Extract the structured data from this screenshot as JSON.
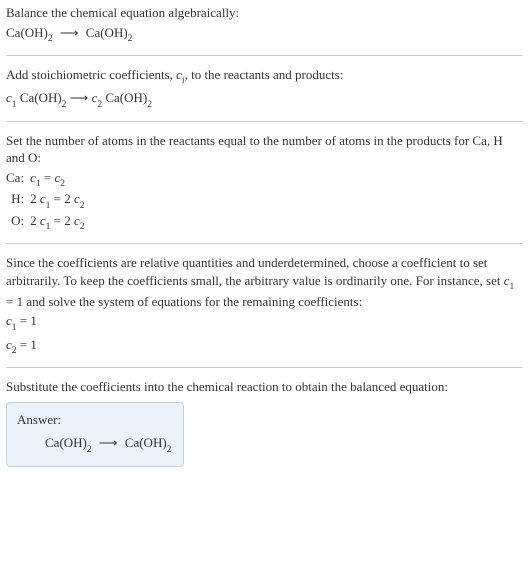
{
  "s1": {
    "l1": "Balance the chemical equation algebraically:",
    "eq_lhs_base": "Ca(OH)",
    "eq_lhs_sub": "2",
    "arrow": "⟶",
    "eq_rhs_base": "Ca(OH)",
    "eq_rhs_sub": "2"
  },
  "s2": {
    "l1_a": "Add stoichiometric coefficients, ",
    "l1_ci": "c",
    "l1_ci_sub": "i",
    "l1_b": ", to the reactants and products:",
    "c1": "c",
    "c1s": "1",
    "sp1": " ",
    "base1": "Ca(OH)",
    "sub1": "2",
    "arrow": " ⟶ ",
    "c2": "c",
    "c2s": "2",
    "sp2": " ",
    "base2": "Ca(OH)",
    "sub2": "2"
  },
  "s3": {
    "l1": "Set the number of atoms in the reactants equal to the number of atoms in the products for Ca, H and O:",
    "rows": [
      {
        "el": "Ca:",
        "lhs_coef": "",
        "lhs_c": "c",
        "lhs_cs": "1",
        "eq": " = ",
        "rhs_coef": "",
        "rhs_c": "c",
        "rhs_cs": "2"
      },
      {
        "el": "H:",
        "lhs_coef": "2 ",
        "lhs_c": "c",
        "lhs_cs": "1",
        "eq": " = ",
        "rhs_coef": "2 ",
        "rhs_c": "c",
        "rhs_cs": "2"
      },
      {
        "el": "O:",
        "lhs_coef": "2 ",
        "lhs_c": "c",
        "lhs_cs": "1",
        "eq": " = ",
        "rhs_coef": "2 ",
        "rhs_c": "c",
        "rhs_cs": "2"
      }
    ]
  },
  "s4": {
    "l1a": "Since the coefficients are relative quantities and underdetermined, choose a coefficient to set arbitrarily. To keep the coefficients small, the arbitrary value is ordinarily one. For instance, set ",
    "c": "c",
    "cs": "1",
    "eq1": " = 1",
    "l1b": " and solve the system of equations for the remaining coefficients:",
    "r1_c": "c",
    "r1_cs": "1",
    "r1_v": " = 1",
    "r2_c": "c",
    "r2_cs": "2",
    "r2_v": " = 1"
  },
  "s5": {
    "l1": "Substitute the coefficients into the chemical reaction to obtain the balanced equation:",
    "ans_label": "Answer:",
    "eq_lhs_base": "Ca(OH)",
    "eq_lhs_sub": "2",
    "arrow": "⟶",
    "eq_rhs_base": "Ca(OH)",
    "eq_rhs_sub": "2"
  }
}
